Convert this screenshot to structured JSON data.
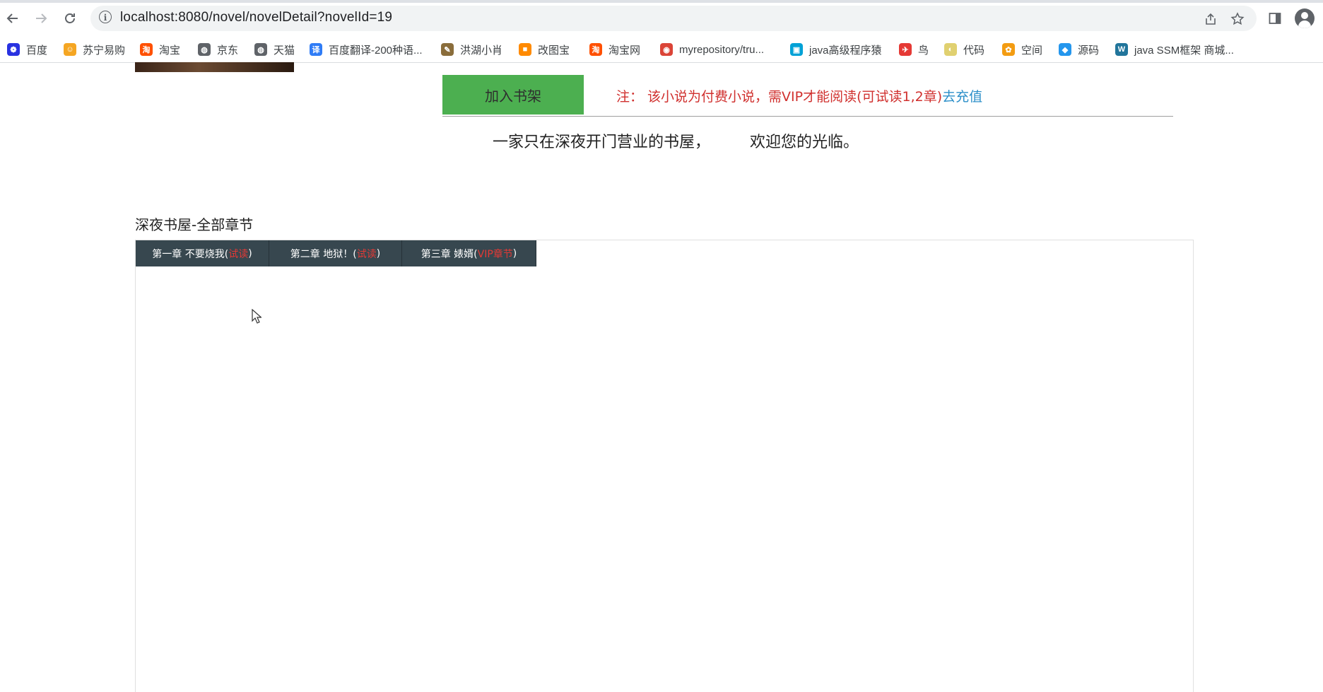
{
  "browser": {
    "url": "localhost:8080/novel/novelDetail?novelId=19",
    "bookmarks": [
      {
        "label": "百度",
        "icon": "baidu-paw-icon",
        "color": "#2932e1"
      },
      {
        "label": "苏宁易购",
        "icon": "suning-lion-icon",
        "color": "#f5a623"
      },
      {
        "label": "淘宝",
        "icon": "taobao-icon",
        "color": "#ff5000"
      },
      {
        "label": "京东",
        "icon": "globe-icon",
        "color": "#5f6368"
      },
      {
        "label": "天猫",
        "icon": "globe-icon",
        "color": "#5f6368"
      },
      {
        "label": "百度翻译-200种语...",
        "icon": "translate-icon",
        "color": "#2f7cf6"
      },
      {
        "label": "洪湖小肖",
        "icon": "bird-icon",
        "color": "#8a6d3b"
      },
      {
        "label": "改图宝",
        "icon": "gaitubao-icon",
        "color": "#ff8a00"
      },
      {
        "label": "淘宝网",
        "icon": "taobao-icon",
        "color": "#ff5000"
      },
      {
        "label": "myrepository/tru...",
        "icon": "chrome-icon",
        "color": "#db4437"
      },
      {
        "label": "java高级程序猿",
        "icon": "bilibili-icon",
        "color": "#00a1d6"
      },
      {
        "label": "鸟",
        "icon": "swift-bird-icon",
        "color": "#e53935"
      },
      {
        "label": "代码",
        "icon": "egg-icon",
        "color": "#e0d070"
      },
      {
        "label": "空间",
        "icon": "qzone-icon",
        "color": "#f39c12"
      },
      {
        "label": "源码",
        "icon": "docker-whale-icon",
        "color": "#2496ed"
      },
      {
        "label": "java SSM框架 商城...",
        "icon": "wordpress-icon",
        "color": "#21759b"
      }
    ]
  },
  "book": {
    "add_to_shelf": "加入书架",
    "notice": "注： 该小说为付费小说，需VIP才能阅读(可试读1,2章)",
    "recharge": "去充值",
    "intro": "一家只在深夜开门营业的书屋，        欢迎您的光临。"
  },
  "chapters": {
    "title": "深夜书屋-全部章节",
    "tabs": [
      {
        "name": "第一章 不要烧我(",
        "tag": "试读",
        "close": ")"
      },
      {
        "name": "第二章 地狱！(",
        "tag": "试读",
        "close": ")"
      },
      {
        "name": "第三章 婊婿(",
        "tag": "VIP章节",
        "close": ")"
      }
    ]
  }
}
